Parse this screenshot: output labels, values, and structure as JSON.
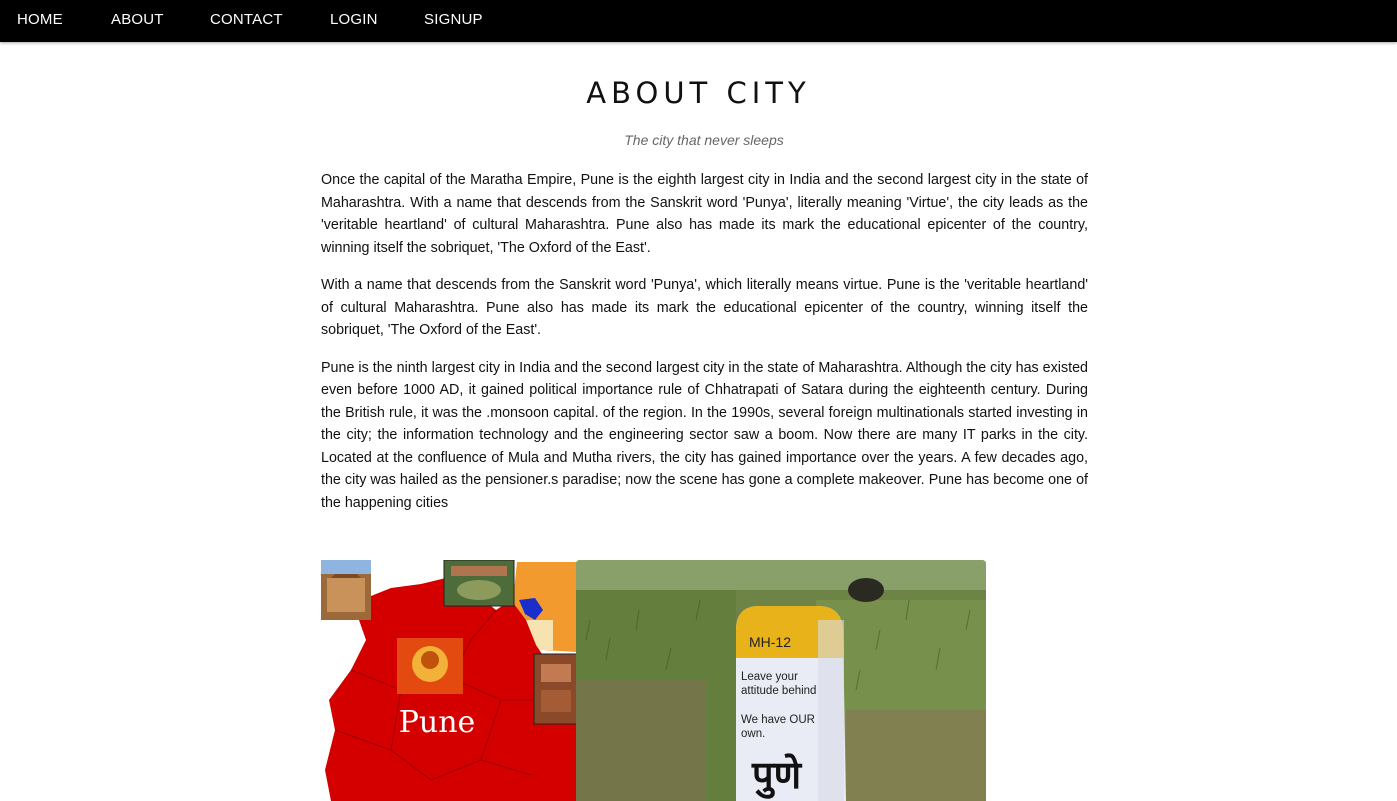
{
  "nav": {
    "items": [
      {
        "label": "HOME"
      },
      {
        "label": "ABOUT"
      },
      {
        "label": "CONTACT"
      },
      {
        "label": "LOGIN"
      },
      {
        "label": "SIGNUP"
      }
    ]
  },
  "page": {
    "title": "ABOUT CITY",
    "subtitle": "The city that never sleeps",
    "paragraphs": [
      "Once the capital of the Maratha Empire, Pune is the eighth largest city in India and the second largest city in the state of Maharashtra. With a name that descends from the Sanskrit word 'Punya', literally meaning 'Virtue', the city leads as the 'veritable heartland' of cultural Maharashtra. Pune also has made its mark the educational epicenter of the country, winning itself the sobriquet, 'The Oxford of the East'.",
      "With a name that descends from the Sanskrit word 'Punya', which literally means virtue. Pune is the 'veritable heartland' of cultural Maharashtra. Pune also has made its mark the educational epicenter of the country, winning itself the sobriquet, 'The Oxford of the East'.",
      "Pune is the ninth largest city in India and the second largest city in the state of Maharashtra. Although the city has existed even before 1000 AD, it gained political importance rule of Chhatrapati of Satara during the eighteenth century. During the British rule, it was the .monsoon capital. of the region. In the 1990s, several foreign multinationals started investing in the city; the information technology and the engineering sector saw a boom. Now there are many IT parks in the city. Located at the confluence of Mula and Mutha rivers, the city has gained importance over the years. A few decades ago, the city was hailed as the pensioner.s paradise; now the scene has gone a complete makeover. Pune has become one of the happening cities"
    ]
  },
  "gallery": {
    "map_label": "Pune",
    "stone": {
      "code": "MH-12",
      "line1": "Leave your",
      "line2": "attitude behind",
      "line3": "We have OUR",
      "line4": "own.",
      "marathi": "पुणे"
    }
  },
  "colors": {
    "navbar": "#000000",
    "nav_text": "#ffffff",
    "map_red": "#d40000",
    "stone_yellow": "#e8b21a"
  }
}
